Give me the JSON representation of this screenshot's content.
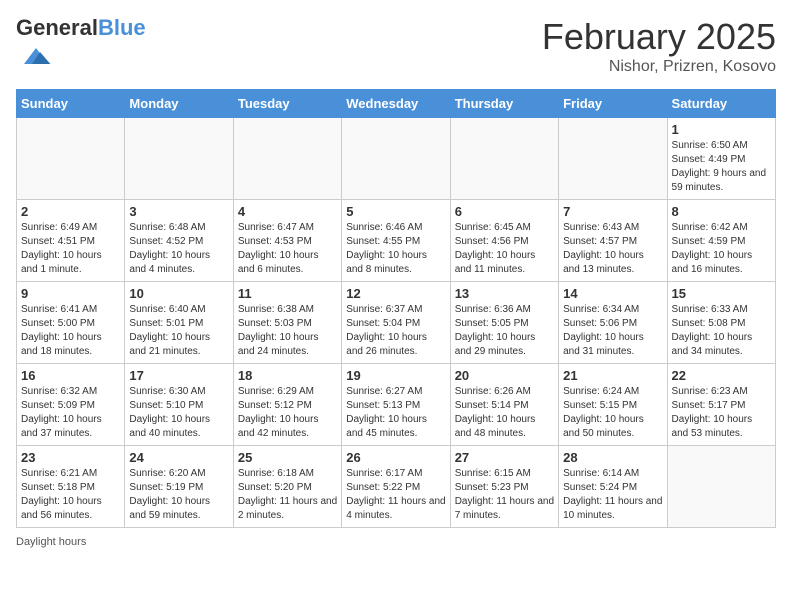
{
  "header": {
    "logo_general": "General",
    "logo_blue": "Blue",
    "month": "February 2025",
    "location": "Nishor, Prizren, Kosovo"
  },
  "weekdays": [
    "Sunday",
    "Monday",
    "Tuesday",
    "Wednesday",
    "Thursday",
    "Friday",
    "Saturday"
  ],
  "weeks": [
    [
      {
        "day": "",
        "info": ""
      },
      {
        "day": "",
        "info": ""
      },
      {
        "day": "",
        "info": ""
      },
      {
        "day": "",
        "info": ""
      },
      {
        "day": "",
        "info": ""
      },
      {
        "day": "",
        "info": ""
      },
      {
        "day": "1",
        "info": "Sunrise: 6:50 AM\nSunset: 4:49 PM\nDaylight: 9 hours and 59 minutes."
      }
    ],
    [
      {
        "day": "2",
        "info": "Sunrise: 6:49 AM\nSunset: 4:51 PM\nDaylight: 10 hours and 1 minute."
      },
      {
        "day": "3",
        "info": "Sunrise: 6:48 AM\nSunset: 4:52 PM\nDaylight: 10 hours and 4 minutes."
      },
      {
        "day": "4",
        "info": "Sunrise: 6:47 AM\nSunset: 4:53 PM\nDaylight: 10 hours and 6 minutes."
      },
      {
        "day": "5",
        "info": "Sunrise: 6:46 AM\nSunset: 4:55 PM\nDaylight: 10 hours and 8 minutes."
      },
      {
        "day": "6",
        "info": "Sunrise: 6:45 AM\nSunset: 4:56 PM\nDaylight: 10 hours and 11 minutes."
      },
      {
        "day": "7",
        "info": "Sunrise: 6:43 AM\nSunset: 4:57 PM\nDaylight: 10 hours and 13 minutes."
      },
      {
        "day": "8",
        "info": "Sunrise: 6:42 AM\nSunset: 4:59 PM\nDaylight: 10 hours and 16 minutes."
      }
    ],
    [
      {
        "day": "9",
        "info": "Sunrise: 6:41 AM\nSunset: 5:00 PM\nDaylight: 10 hours and 18 minutes."
      },
      {
        "day": "10",
        "info": "Sunrise: 6:40 AM\nSunset: 5:01 PM\nDaylight: 10 hours and 21 minutes."
      },
      {
        "day": "11",
        "info": "Sunrise: 6:38 AM\nSunset: 5:03 PM\nDaylight: 10 hours and 24 minutes."
      },
      {
        "day": "12",
        "info": "Sunrise: 6:37 AM\nSunset: 5:04 PM\nDaylight: 10 hours and 26 minutes."
      },
      {
        "day": "13",
        "info": "Sunrise: 6:36 AM\nSunset: 5:05 PM\nDaylight: 10 hours and 29 minutes."
      },
      {
        "day": "14",
        "info": "Sunrise: 6:34 AM\nSunset: 5:06 PM\nDaylight: 10 hours and 31 minutes."
      },
      {
        "day": "15",
        "info": "Sunrise: 6:33 AM\nSunset: 5:08 PM\nDaylight: 10 hours and 34 minutes."
      }
    ],
    [
      {
        "day": "16",
        "info": "Sunrise: 6:32 AM\nSunset: 5:09 PM\nDaylight: 10 hours and 37 minutes."
      },
      {
        "day": "17",
        "info": "Sunrise: 6:30 AM\nSunset: 5:10 PM\nDaylight: 10 hours and 40 minutes."
      },
      {
        "day": "18",
        "info": "Sunrise: 6:29 AM\nSunset: 5:12 PM\nDaylight: 10 hours and 42 minutes."
      },
      {
        "day": "19",
        "info": "Sunrise: 6:27 AM\nSunset: 5:13 PM\nDaylight: 10 hours and 45 minutes."
      },
      {
        "day": "20",
        "info": "Sunrise: 6:26 AM\nSunset: 5:14 PM\nDaylight: 10 hours and 48 minutes."
      },
      {
        "day": "21",
        "info": "Sunrise: 6:24 AM\nSunset: 5:15 PM\nDaylight: 10 hours and 50 minutes."
      },
      {
        "day": "22",
        "info": "Sunrise: 6:23 AM\nSunset: 5:17 PM\nDaylight: 10 hours and 53 minutes."
      }
    ],
    [
      {
        "day": "23",
        "info": "Sunrise: 6:21 AM\nSunset: 5:18 PM\nDaylight: 10 hours and 56 minutes."
      },
      {
        "day": "24",
        "info": "Sunrise: 6:20 AM\nSunset: 5:19 PM\nDaylight: 10 hours and 59 minutes."
      },
      {
        "day": "25",
        "info": "Sunrise: 6:18 AM\nSunset: 5:20 PM\nDaylight: 11 hours and 2 minutes."
      },
      {
        "day": "26",
        "info": "Sunrise: 6:17 AM\nSunset: 5:22 PM\nDaylight: 11 hours and 4 minutes."
      },
      {
        "day": "27",
        "info": "Sunrise: 6:15 AM\nSunset: 5:23 PM\nDaylight: 11 hours and 7 minutes."
      },
      {
        "day": "28",
        "info": "Sunrise: 6:14 AM\nSunset: 5:24 PM\nDaylight: 11 hours and 10 minutes."
      },
      {
        "day": "",
        "info": ""
      }
    ]
  ],
  "footer": {
    "daylight_label": "Daylight hours"
  }
}
